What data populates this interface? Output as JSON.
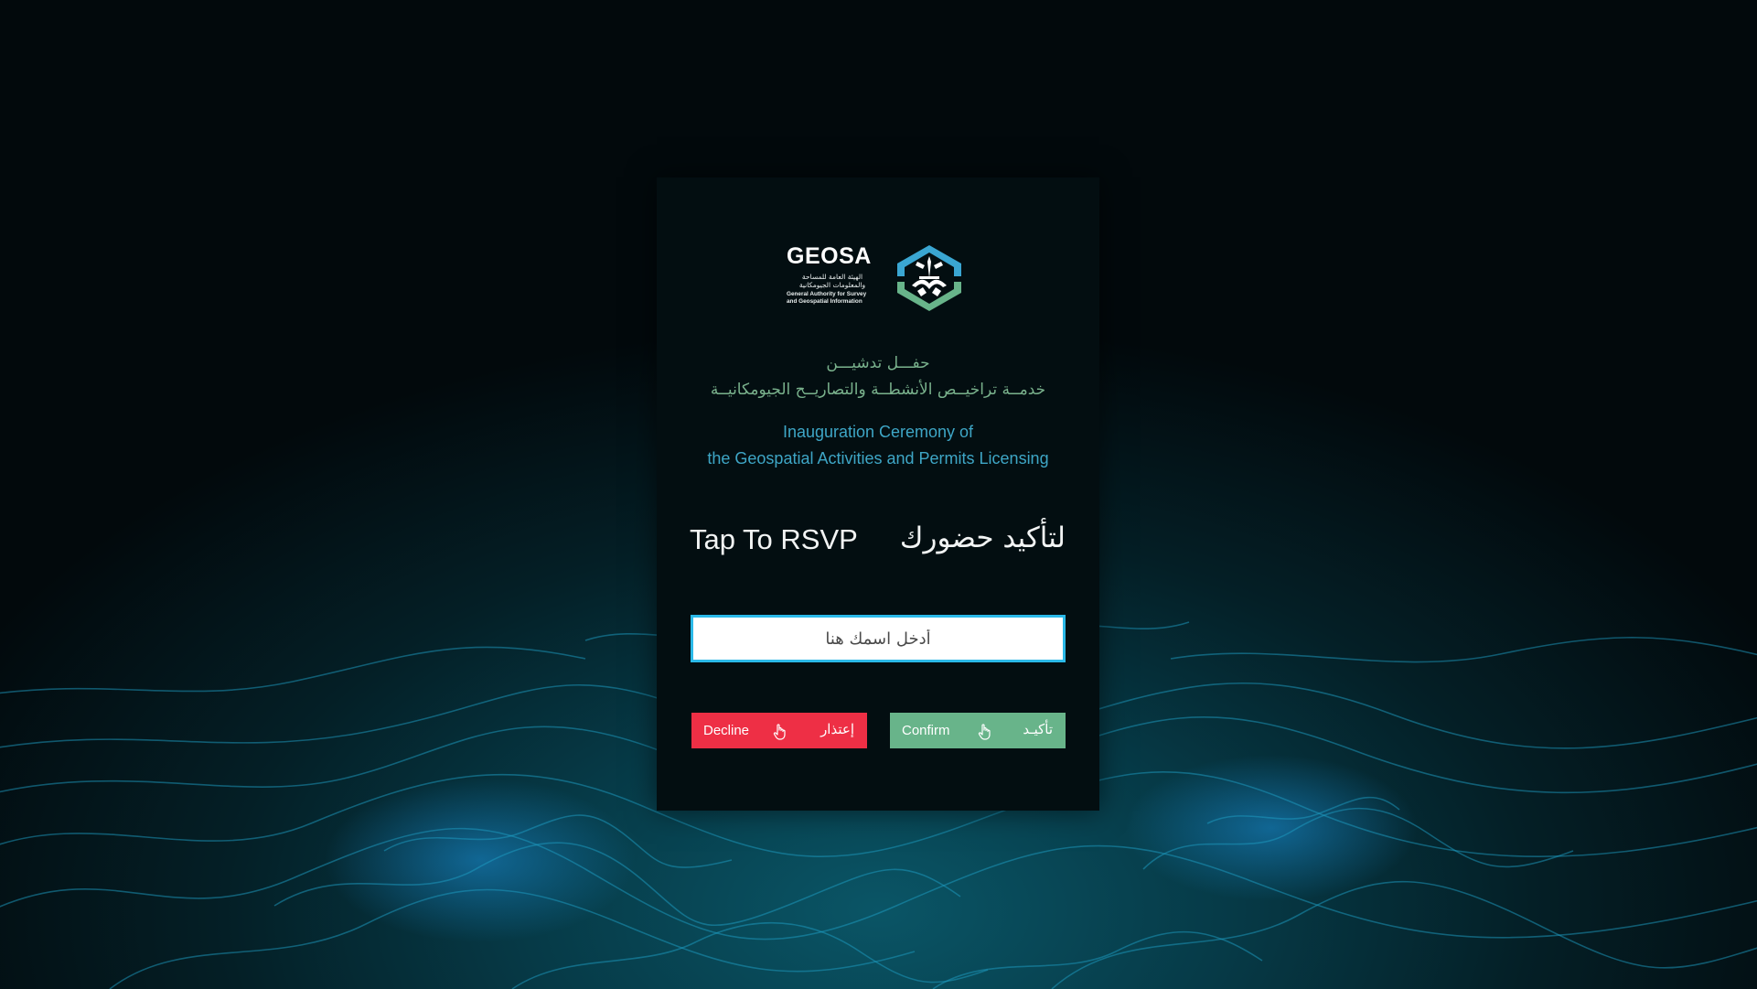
{
  "logo": {
    "wordmark": "GEOSA",
    "arabic_name_line1": "الهيئة العامة للمساحة",
    "arabic_name_line2": "والمعلومات الجيومكانية",
    "english_name_line1": "General Authority for Survey",
    "english_name_line2": "and Geospatial Information",
    "colors": {
      "blue": "#3aa6d2",
      "green": "#68b48a",
      "white": "#ffffff"
    }
  },
  "event": {
    "title_ar_line1": "حفـــل تدشيـــن",
    "title_ar_line2": "خدمــة تراخيــص الأنشطــة والتصاريــح الجيومكانيــة",
    "title_en_line1": "Inauguration Ceremony of",
    "title_en_line2": "the Geospatial Activities and Permits Licensing"
  },
  "rsvp": {
    "label_en": "Tap To RSVP",
    "label_ar": "لتأكيد حضورك"
  },
  "name_input": {
    "placeholder": "أدخل اسمك هنا",
    "value": ""
  },
  "buttons": {
    "decline": {
      "label_en": "Decline",
      "label_ar": "إعتذار",
      "icon": "hand-pointer-icon",
      "color": "#ee2f45"
    },
    "confirm": {
      "label_en": "Confirm",
      "label_ar": "تأكيـد",
      "icon": "hand-pointer-icon",
      "color": "#68b48a"
    }
  },
  "theme": {
    "background": "#03181d",
    "card": "#030e11",
    "accent_cyan": "#2bb9e8"
  }
}
